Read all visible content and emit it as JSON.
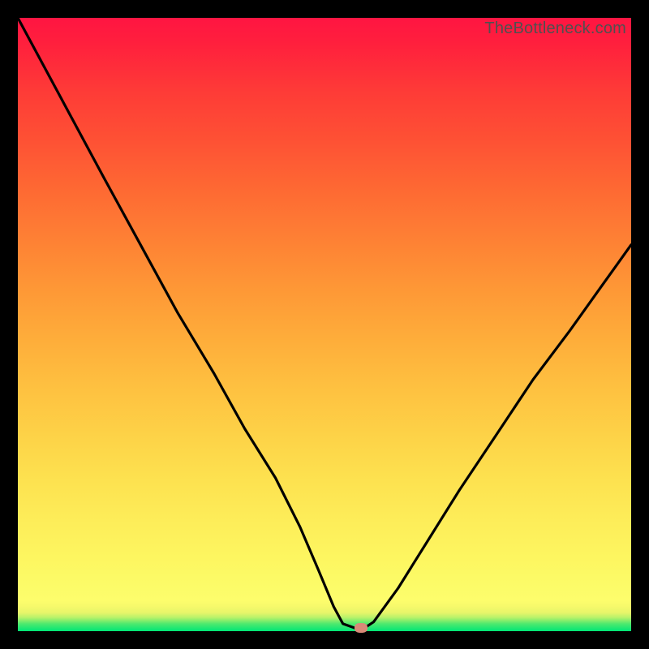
{
  "watermark": "TheBottleneck.com",
  "colors": {
    "frame": "#000000",
    "gradient_top": "#ff1542",
    "gradient_mid": "#fdf660",
    "gradient_bottom": "#00e676",
    "curve": "#000000",
    "marker": "#d88a78"
  },
  "chart_data": {
    "type": "line",
    "title": "",
    "xlabel": "",
    "ylabel": "",
    "xlim": [
      0,
      100
    ],
    "ylim": [
      0,
      100
    ],
    "series": [
      {
        "name": "bottleneck-curve",
        "x": [
          0,
          7,
          14,
          20,
          26,
          32,
          37,
          42,
          46,
          49,
          51.5,
          53,
          55,
          56.5,
          58,
          62,
          67,
          72,
          78,
          84,
          90,
          95,
          100
        ],
        "values": [
          100,
          87,
          74,
          63,
          52,
          42,
          33,
          25,
          17,
          10,
          4,
          1.2,
          0.5,
          0.5,
          1.5,
          7,
          15,
          23,
          32,
          41,
          49,
          56,
          63
        ]
      }
    ],
    "annotations": [
      {
        "name": "optimal-marker",
        "x": 56,
        "y": 0.5
      }
    ],
    "grid": false,
    "legend": false
  }
}
